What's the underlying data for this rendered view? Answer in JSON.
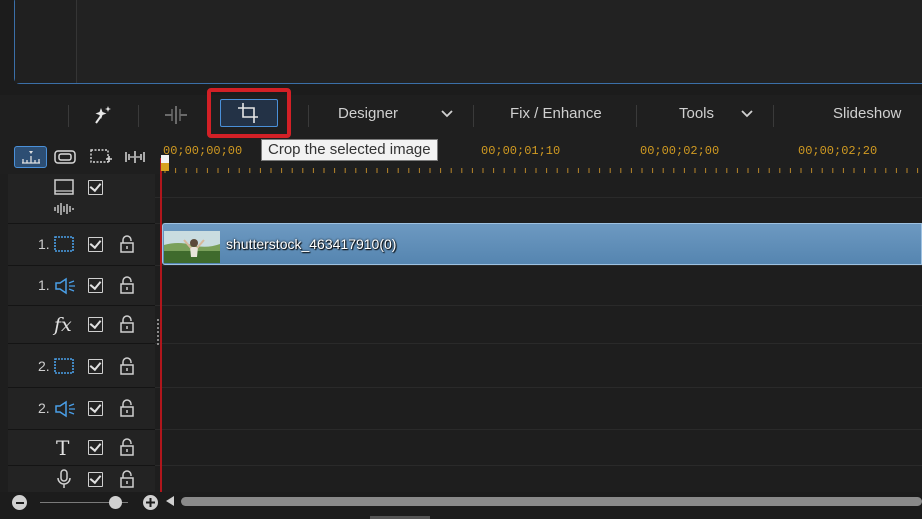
{
  "toolbar": {
    "designer_label": "Designer",
    "fix_enhance_label": "Fix / Enhance",
    "tools_label": "Tools",
    "slideshow_label": "Slideshow",
    "icons": [
      "magic-wand-icon",
      "split-icon",
      "crop-icon",
      "chevron-down-icon"
    ]
  },
  "tooltip": {
    "text": "Crop the selected image"
  },
  "header_buttons": [
    "timeline-mode-icon",
    "storyboard-mode-icon",
    "add-screen-icon",
    "audio-mix-icon"
  ],
  "ruler": {
    "timecodes": [
      "00;00;00;00",
      "00;00;01;10",
      "00;00;02;00",
      "00;00;02;20"
    ]
  },
  "tracks": [
    {
      "kind": "master",
      "number": "",
      "icon": "video-track-icon"
    },
    {
      "kind": "video",
      "number": "1.",
      "icon": "video-track-icon"
    },
    {
      "kind": "audio",
      "number": "1.",
      "icon": "speaker-icon"
    },
    {
      "kind": "effect",
      "number": "",
      "icon": "fx-icon",
      "glyph": "fx"
    },
    {
      "kind": "video",
      "number": "2.",
      "icon": "video-track-icon"
    },
    {
      "kind": "audio",
      "number": "2.",
      "icon": "speaker-icon"
    },
    {
      "kind": "title",
      "number": "",
      "icon": "title-icon",
      "glyph": "T"
    },
    {
      "kind": "voice",
      "number": "",
      "icon": "microphone-icon"
    }
  ],
  "clip": {
    "name": "shutterstock_463417910(0)"
  },
  "colors": {
    "accent_blue": "#4a90d9",
    "highlight_red": "#d32026",
    "timecode_orange": "#d09a22",
    "clip_blue": "#5d8fbc"
  }
}
